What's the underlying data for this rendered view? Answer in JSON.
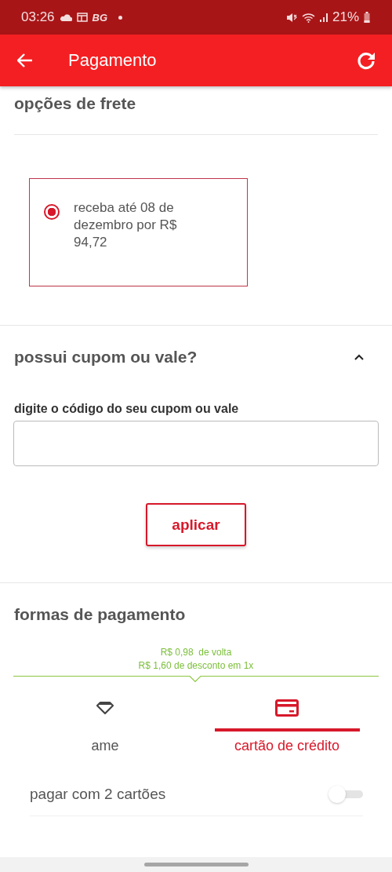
{
  "status_bar": {
    "time": "03:26",
    "badge": "BG",
    "battery": "21%"
  },
  "app_bar": {
    "title": "Pagamento"
  },
  "shipping": {
    "title": "opções de frete",
    "options": [
      {
        "text": "receba até 08 de dezembro por R$ 94,72",
        "selected": true
      }
    ]
  },
  "coupon": {
    "title": "possui cupom ou vale?",
    "expanded": true,
    "label": "digite o código do seu cupom ou vale",
    "button": "aplicar"
  },
  "payment": {
    "title": "formas de pagamento",
    "cashback": [
      "R$ 0,98  de volta",
      "R$ 1,60 de desconto em 1x"
    ],
    "tabs": [
      {
        "label": "ame",
        "kind": "wallet",
        "selected": false
      },
      {
        "label": "cartão de crédito",
        "kind": "card",
        "selected": true
      }
    ],
    "two_cards": {
      "label": "pagar com 2 cartões",
      "on": false
    }
  }
}
